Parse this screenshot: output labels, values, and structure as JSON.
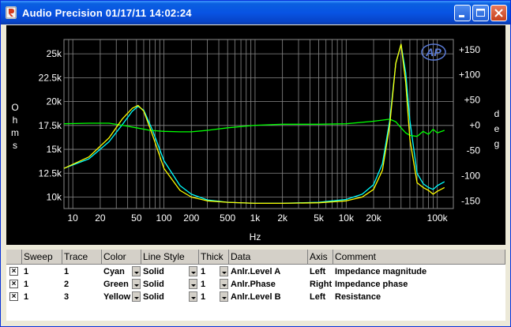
{
  "window": {
    "title": "Audio Precision  01/17/11 14:02:24",
    "controls": [
      "minimize-icon",
      "maximize-icon",
      "close-icon"
    ]
  },
  "chart_data": {
    "type": "line",
    "title": "",
    "xlabel": "Hz",
    "ylabel_left": "Ohms",
    "ylabel_right": "deg",
    "x_scale": "log",
    "xlim": [
      8,
      150000
    ],
    "ylim_left": [
      8800,
      26500
    ],
    "ylim_right": [
      -165,
      170
    ],
    "x_ticks": [
      {
        "v": 10,
        "label": "10"
      },
      {
        "v": 20,
        "label": "20"
      },
      {
        "v": 50,
        "label": "50"
      },
      {
        "v": 100,
        "label": "100"
      },
      {
        "v": 200,
        "label": "200"
      },
      {
        "v": 500,
        "label": "500"
      },
      {
        "v": 1000,
        "label": "1k"
      },
      {
        "v": 2000,
        "label": "2k"
      },
      {
        "v": 5000,
        "label": "5k"
      },
      {
        "v": 10000,
        "label": "10k"
      },
      {
        "v": 20000,
        "label": "20k"
      },
      {
        "v": 100000,
        "label": "100k"
      }
    ],
    "y_ticks_left": [
      {
        "v": 10000,
        "label": "10k"
      },
      {
        "v": 12500,
        "label": "12.5k"
      },
      {
        "v": 15000,
        "label": "15k"
      },
      {
        "v": 17500,
        "label": "17.5k"
      },
      {
        "v": 20000,
        "label": "20k"
      },
      {
        "v": 22500,
        "label": "22.5k"
      },
      {
        "v": 25000,
        "label": "25k"
      }
    ],
    "y_ticks_right": [
      {
        "v": 150,
        "label": "+150"
      },
      {
        "v": 100,
        "label": "+100"
      },
      {
        "v": 50,
        "label": "+50"
      },
      {
        "v": 0,
        "label": "+0"
      },
      {
        "v": -50,
        "label": "-50"
      },
      {
        "v": -100,
        "label": "-100"
      },
      {
        "v": -150,
        "label": "-150"
      }
    ],
    "grid": true,
    "series": [
      {
        "name": "Impedance magnitude",
        "color": "#00ffff",
        "axis": "left",
        "x": [
          8,
          15,
          25,
          35,
          45,
          52,
          60,
          75,
          100,
          150,
          200,
          300,
          500,
          1000,
          2000,
          5000,
          10000,
          15000,
          20000,
          25000,
          30000,
          35000,
          40000,
          45000,
          50000,
          60000,
          70000,
          80000,
          90000,
          100000,
          120000
        ],
        "y": [
          13000,
          14000,
          15800,
          17600,
          19000,
          19500,
          19100,
          17000,
          13800,
          11200,
          10300,
          9700,
          9450,
          9350,
          9350,
          9450,
          9750,
          10300,
          11300,
          13500,
          18000,
          24000,
          26000,
          23000,
          18000,
          12500,
          11400,
          11000,
          10800,
          11200,
          11600
        ]
      },
      {
        "name": "Impedance phase",
        "color": "#00ff00",
        "axis": "right",
        "x": [
          8,
          15,
          25,
          35,
          50,
          70,
          100,
          150,
          200,
          300,
          500,
          1000,
          2000,
          5000,
          10000,
          20000,
          30000,
          35000,
          40000,
          45000,
          50000,
          60000,
          70000,
          80000,
          90000,
          100000,
          120000
        ],
        "y": [
          3,
          4,
          4,
          0,
          -5,
          -10,
          -12,
          -13,
          -13,
          -10,
          -5,
          0,
          2,
          2,
          3,
          8,
          12,
          7,
          -5,
          -15,
          -20,
          -22,
          -12,
          -18,
          -8,
          -15,
          -10
        ]
      },
      {
        "name": "Resistance",
        "color": "#ffff00",
        "axis": "left",
        "x": [
          8,
          15,
          25,
          35,
          45,
          52,
          60,
          75,
          100,
          150,
          200,
          300,
          500,
          1000,
          2000,
          5000,
          10000,
          15000,
          20000,
          25000,
          30000,
          35000,
          40000,
          45000,
          50000,
          60000,
          70000,
          80000,
          90000,
          100000,
          120000
        ],
        "y": [
          13000,
          14200,
          16200,
          18200,
          19300,
          19600,
          19000,
          16500,
          13000,
          10700,
          10000,
          9600,
          9450,
          9350,
          9350,
          9400,
          9600,
          10000,
          10800,
          12800,
          17500,
          24000,
          26000,
          22000,
          16000,
          11500,
          11000,
          10700,
          10300,
          10600,
          11000
        ]
      }
    ]
  },
  "table": {
    "headers": [
      "",
      "Sweep",
      "Trace",
      "Color",
      "Line Style",
      "Thick",
      "Data",
      "Axis",
      "Comment"
    ],
    "rows": [
      {
        "checked": "×",
        "sweep": "1",
        "trace": "1",
        "color": "Cyan",
        "line_style": "Solid",
        "thick": "1",
        "data": "Anlr.Level A",
        "axis": "Left",
        "comment": "Impedance magnitude"
      },
      {
        "checked": "×",
        "sweep": "1",
        "trace": "2",
        "color": "Green",
        "line_style": "Solid",
        "thick": "1",
        "data": "Anlr.Phase",
        "axis": "Right",
        "comment": "Impedance phase"
      },
      {
        "checked": "×",
        "sweep": "1",
        "trace": "3",
        "color": "Yellow",
        "line_style": "Solid",
        "thick": "1",
        "data": "Anlr.Level B",
        "axis": "Left",
        "comment": "Resistance"
      }
    ]
  },
  "logo_text": "AP"
}
